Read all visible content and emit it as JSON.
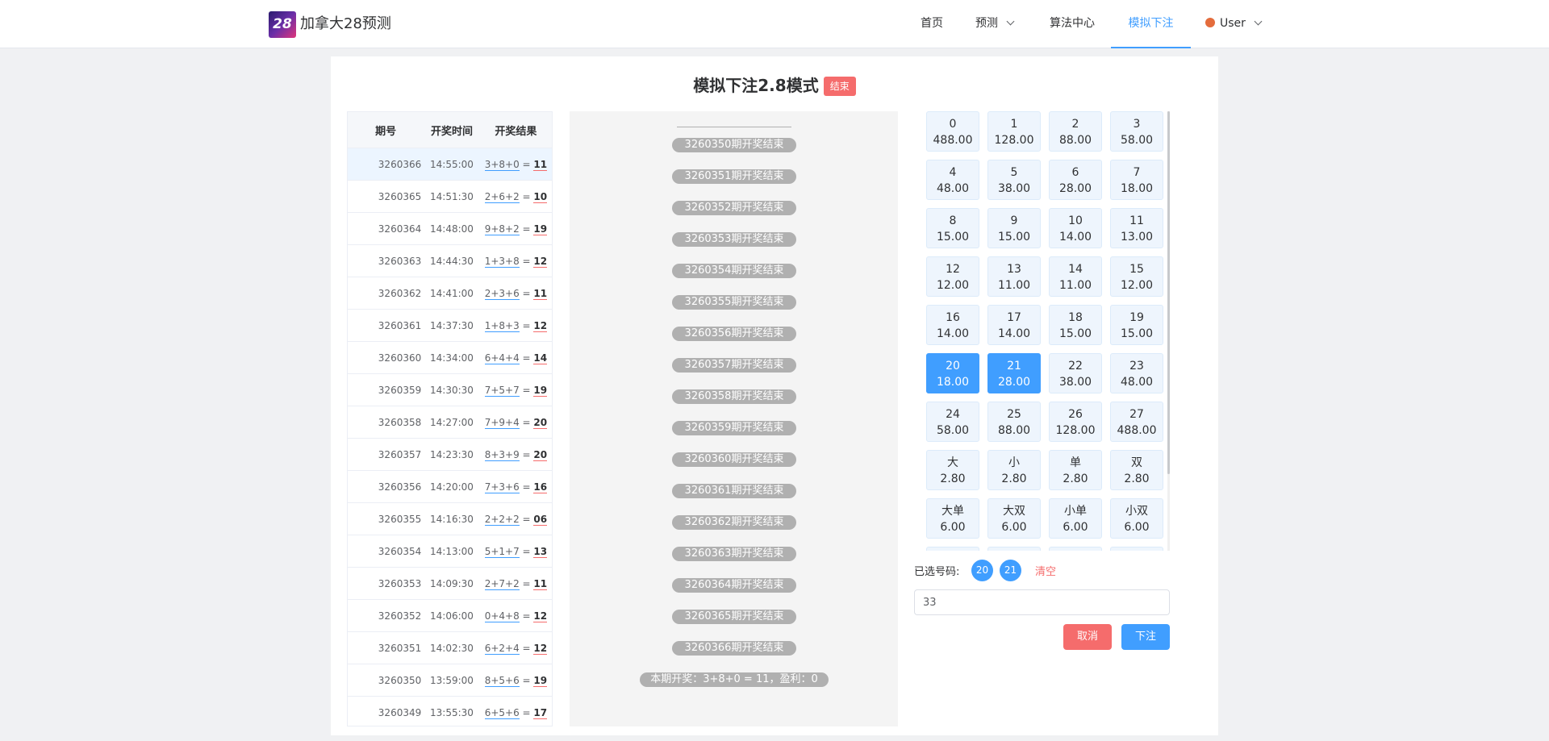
{
  "header": {
    "logo_text": "28",
    "brand": "加拿大28预测",
    "nav": [
      {
        "label": "首页"
      },
      {
        "label": "预测"
      },
      {
        "label": "算法中心"
      },
      {
        "label": "模拟下注"
      },
      {
        "label": "User"
      }
    ]
  },
  "page": {
    "title": "模拟下注2.8模式",
    "status_tag": "结束"
  },
  "table": {
    "headers": [
      "期号",
      "开奖时间",
      "开奖结果"
    ],
    "rows": [
      {
        "period": "3260366",
        "time": "14:55:00",
        "dice": "3+8+0",
        "sum": "11"
      },
      {
        "period": "3260365",
        "time": "14:51:30",
        "dice": "2+6+2",
        "sum": "10"
      },
      {
        "period": "3260364",
        "time": "14:48:00",
        "dice": "9+8+2",
        "sum": "19"
      },
      {
        "period": "3260363",
        "time": "14:44:30",
        "dice": "1+3+8",
        "sum": "12"
      },
      {
        "period": "3260362",
        "time": "14:41:00",
        "dice": "2+3+6",
        "sum": "11"
      },
      {
        "period": "3260361",
        "time": "14:37:30",
        "dice": "1+8+3",
        "sum": "12"
      },
      {
        "period": "3260360",
        "time": "14:34:00",
        "dice": "6+4+4",
        "sum": "14"
      },
      {
        "period": "3260359",
        "time": "14:30:30",
        "dice": "7+5+7",
        "sum": "19"
      },
      {
        "period": "3260358",
        "time": "14:27:00",
        "dice": "7+9+4",
        "sum": "20"
      },
      {
        "period": "3260357",
        "time": "14:23:30",
        "dice": "8+3+9",
        "sum": "20"
      },
      {
        "period": "3260356",
        "time": "14:20:00",
        "dice": "7+3+6",
        "sum": "16"
      },
      {
        "period": "3260355",
        "time": "14:16:30",
        "dice": "2+2+2",
        "sum": "06"
      },
      {
        "period": "3260354",
        "time": "14:13:00",
        "dice": "5+1+7",
        "sum": "13"
      },
      {
        "period": "3260353",
        "time": "14:09:30",
        "dice": "2+7+2",
        "sum": "11"
      },
      {
        "period": "3260352",
        "time": "14:06:00",
        "dice": "0+4+8",
        "sum": "12"
      },
      {
        "period": "3260351",
        "time": "14:02:30",
        "dice": "6+2+4",
        "sum": "12"
      },
      {
        "period": "3260350",
        "time": "13:59:00",
        "dice": "8+5+6",
        "sum": "19"
      },
      {
        "period": "3260349",
        "time": "13:55:30",
        "dice": "6+5+6",
        "sum": "17"
      }
    ]
  },
  "log": {
    "messages": [
      "3260350期开奖结束",
      "3260351期开奖结束",
      "3260352期开奖结束",
      "3260353期开奖结束",
      "3260354期开奖结束",
      "3260355期开奖结束",
      "3260356期开奖结束",
      "3260357期开奖结束",
      "3260358期开奖结束",
      "3260359期开奖结束",
      "3260360期开奖结束",
      "3260361期开奖结束",
      "3260362期开奖结束",
      "3260363期开奖结束",
      "3260364期开奖结束",
      "3260365期开奖结束",
      "3260366期开奖结束"
    ],
    "summary": "本期开奖：3+8+0 = 11，盈利：0"
  },
  "grid": {
    "cells": [
      {
        "label": "0",
        "odds": "488.00"
      },
      {
        "label": "1",
        "odds": "128.00"
      },
      {
        "label": "2",
        "odds": "88.00"
      },
      {
        "label": "3",
        "odds": "58.00"
      },
      {
        "label": "4",
        "odds": "48.00"
      },
      {
        "label": "5",
        "odds": "38.00"
      },
      {
        "label": "6",
        "odds": "28.00"
      },
      {
        "label": "7",
        "odds": "18.00"
      },
      {
        "label": "8",
        "odds": "15.00"
      },
      {
        "label": "9",
        "odds": "15.00"
      },
      {
        "label": "10",
        "odds": "14.00"
      },
      {
        "label": "11",
        "odds": "13.00"
      },
      {
        "label": "12",
        "odds": "12.00"
      },
      {
        "label": "13",
        "odds": "11.00"
      },
      {
        "label": "14",
        "odds": "11.00"
      },
      {
        "label": "15",
        "odds": "12.00"
      },
      {
        "label": "16",
        "odds": "14.00"
      },
      {
        "label": "17",
        "odds": "14.00"
      },
      {
        "label": "18",
        "odds": "15.00"
      },
      {
        "label": "19",
        "odds": "15.00"
      },
      {
        "label": "20",
        "odds": "18.00",
        "selected": true
      },
      {
        "label": "21",
        "odds": "28.00",
        "selected": true
      },
      {
        "label": "22",
        "odds": "38.00"
      },
      {
        "label": "23",
        "odds": "48.00"
      },
      {
        "label": "24",
        "odds": "58.00"
      },
      {
        "label": "25",
        "odds": "88.00"
      },
      {
        "label": "26",
        "odds": "128.00"
      },
      {
        "label": "27",
        "odds": "488.00"
      },
      {
        "label": "大",
        "odds": "2.80"
      },
      {
        "label": "小",
        "odds": "2.80"
      },
      {
        "label": "单",
        "odds": "2.80"
      },
      {
        "label": "双",
        "odds": "2.80"
      },
      {
        "label": "大单",
        "odds": "6.00"
      },
      {
        "label": "大双",
        "odds": "6.00"
      },
      {
        "label": "小单",
        "odds": "6.00"
      },
      {
        "label": "小双",
        "odds": "6.00"
      }
    ]
  },
  "bet": {
    "selected_label": "已选号码:",
    "selected_numbers": [
      "20",
      "21"
    ],
    "clear_label": "清空",
    "amount_value": "33",
    "cancel_label": "取消",
    "submit_label": "下注"
  },
  "colors": {
    "primary": "#409eff",
    "danger": "#f56c6c",
    "pill": "#b0b0b0"
  }
}
